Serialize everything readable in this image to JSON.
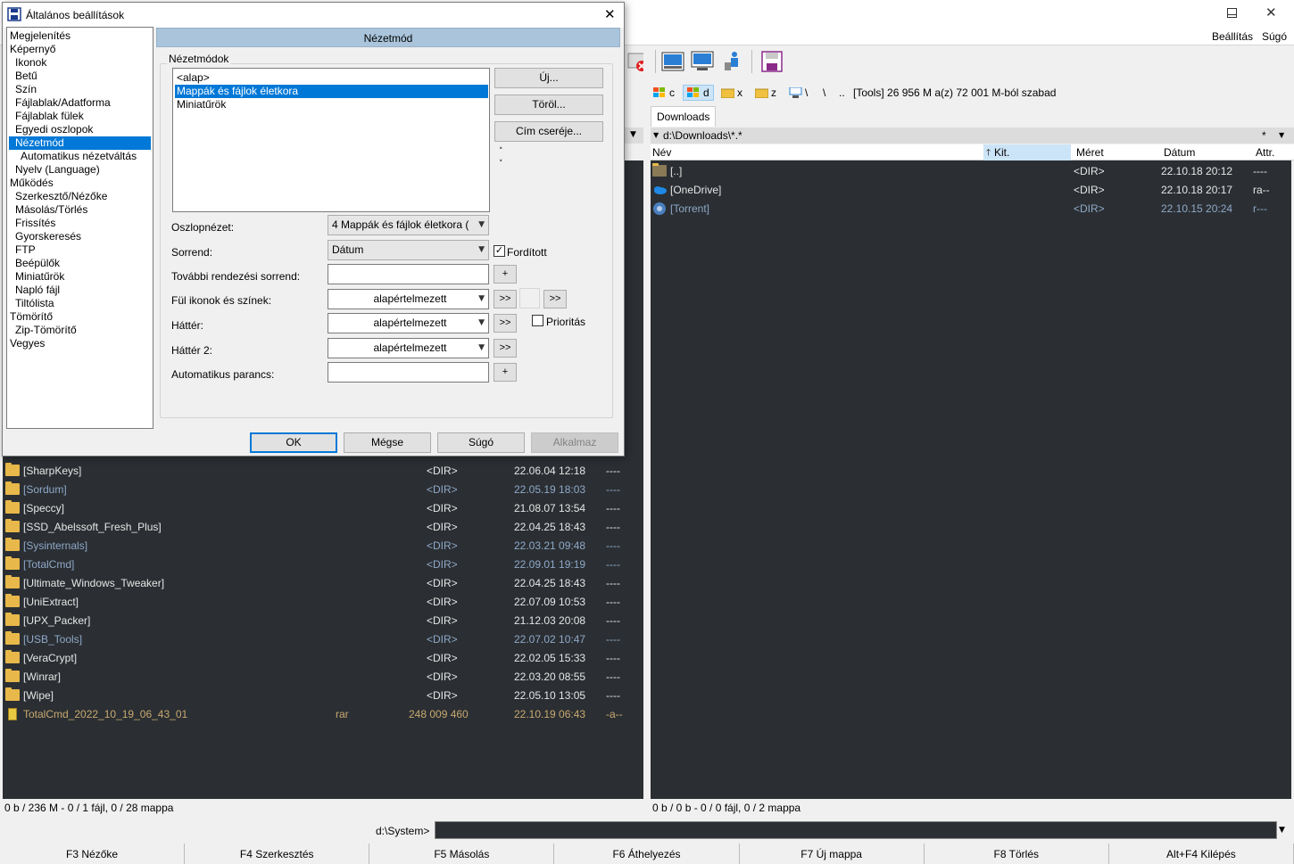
{
  "main": {
    "menu": {
      "settings": "Beállítás",
      "help": "Súgó"
    }
  },
  "drives": {
    "c": "c",
    "d": "d",
    "x": "x",
    "z": "z",
    "net": "\\",
    "root": "\\",
    "up": "..",
    "info": "[Tools]  26 956 M a(z) 72 001 M-ból szabad"
  },
  "right": {
    "tab": "Downloads",
    "path": "d:\\Downloads\\*.*",
    "path_btn": "*",
    "cols": {
      "name": "Név",
      "ext": "Kit.",
      "size": "Méret",
      "date": "Dátum",
      "attr": "Attr."
    },
    "rows": [
      {
        "name": "[..]",
        "size": "<DIR>",
        "date": "22.10.18 20:12",
        "attr": "----"
      },
      {
        "name": "[OneDrive]",
        "size": "<DIR>",
        "date": "22.10.18 20:17",
        "attr": "ra--"
      },
      {
        "name": "[Torrent]",
        "size": "<DIR>",
        "date": "22.10.15 20:24",
        "attr": "r---"
      }
    ],
    "status": "0 b / 0 b - 0 / 0 fájl, 0 / 2 mappa"
  },
  "left": {
    "rows": [
      {
        "name": "[SharpKeys]",
        "ext": "",
        "size": "<DIR>",
        "date": "22.06.04 12:18",
        "attr": "----",
        "kind": "dir"
      },
      {
        "name": "[Sordum]",
        "ext": "",
        "size": "<DIR>",
        "date": "22.05.19 18:03",
        "attr": "----",
        "kind": "dim"
      },
      {
        "name": "[Speccy]",
        "ext": "",
        "size": "<DIR>",
        "date": "21.08.07 13:54",
        "attr": "----",
        "kind": "dir"
      },
      {
        "name": "[SSD_Abelssoft_Fresh_Plus]",
        "ext": "",
        "size": "<DIR>",
        "date": "22.04.25 18:43",
        "attr": "----",
        "kind": "dir"
      },
      {
        "name": "[Sysinternals]",
        "ext": "",
        "size": "<DIR>",
        "date": "22.03.21 09:48",
        "attr": "----",
        "kind": "dim"
      },
      {
        "name": "[TotalCmd]",
        "ext": "",
        "size": "<DIR>",
        "date": "22.09.01 19:19",
        "attr": "----",
        "kind": "dim"
      },
      {
        "name": "[Ultimate_Windows_Tweaker]",
        "ext": "",
        "size": "<DIR>",
        "date": "22.04.25 18:43",
        "attr": "----",
        "kind": "dir"
      },
      {
        "name": "[UniExtract]",
        "ext": "",
        "size": "<DIR>",
        "date": "22.07.09 10:53",
        "attr": "----",
        "kind": "dir"
      },
      {
        "name": "[UPX_Packer]",
        "ext": "",
        "size": "<DIR>",
        "date": "21.12.03 20:08",
        "attr": "----",
        "kind": "dir"
      },
      {
        "name": "[USB_Tools]",
        "ext": "",
        "size": "<DIR>",
        "date": "22.07.02 10:47",
        "attr": "----",
        "kind": "dim"
      },
      {
        "name": "[VeraCrypt]",
        "ext": "",
        "size": "<DIR>",
        "date": "22.02.05 15:33",
        "attr": "----",
        "kind": "dir"
      },
      {
        "name": "[Winrar]",
        "ext": "",
        "size": "<DIR>",
        "date": "22.03.20 08:55",
        "attr": "----",
        "kind": "dir"
      },
      {
        "name": "[Wipe]",
        "ext": "",
        "size": "<DIR>",
        "date": "22.05.10 13:05",
        "attr": "----",
        "kind": "dir"
      },
      {
        "name": "TotalCmd_2022_10_19_06_43_01",
        "ext": "rar",
        "size": "248 009 460",
        "date": "22.10.19 06:43",
        "attr": "-a--",
        "kind": "archive"
      }
    ],
    "status": "0 b / 236 M - 0 / 1 fájl, 0 / 28 mappa"
  },
  "cmd": {
    "prompt": "d:\\System>"
  },
  "fkeys": [
    "F3 Nézőke",
    "F4 Szerkesztés",
    "F5 Másolás",
    "F6 Áthelyezés",
    "F7 Új mappa",
    "F8 Törlés",
    "Alt+F4 Kilépés"
  ],
  "dialog": {
    "title": "Általános beállítások",
    "close": "✕",
    "tree": [
      {
        "label": "Megjelenítés",
        "lvl": 0
      },
      {
        "label": "Képernyő",
        "lvl": 0
      },
      {
        "label": "Ikonok",
        "lvl": 1
      },
      {
        "label": "Betű",
        "lvl": 1
      },
      {
        "label": "Szín",
        "lvl": 1
      },
      {
        "label": "Fájlablak/Adatforma",
        "lvl": 1
      },
      {
        "label": "Fájlablak fülek",
        "lvl": 1
      },
      {
        "label": "Egyedi oszlopok",
        "lvl": 1
      },
      {
        "label": "Nézetmód",
        "lvl": 1,
        "selected": true
      },
      {
        "label": "Automatikus nézetváltás",
        "lvl": 2
      },
      {
        "label": "Nyelv (Language)",
        "lvl": 1
      },
      {
        "label": "Működés",
        "lvl": 0
      },
      {
        "label": "Szerkesztő/Nézőke",
        "lvl": 1
      },
      {
        "label": "Másolás/Törlés",
        "lvl": 1
      },
      {
        "label": "Frissítés",
        "lvl": 1
      },
      {
        "label": "Gyorskeresés",
        "lvl": 1
      },
      {
        "label": "FTP",
        "lvl": 1
      },
      {
        "label": "Beépülők",
        "lvl": 1
      },
      {
        "label": "Miniatűrök",
        "lvl": 1
      },
      {
        "label": "Napló fájl",
        "lvl": 1
      },
      {
        "label": "Tiltólista",
        "lvl": 1
      },
      {
        "label": "Tömörítő",
        "lvl": 0
      },
      {
        "label": "Zip-Tömörítő",
        "lvl": 1
      },
      {
        "label": "Vegyes",
        "lvl": 0
      }
    ],
    "section": "Nézetmód",
    "group": "Nézetmódok",
    "modes": [
      "<alap>",
      "Mappák és fájlok életkora",
      "Miniatűrök"
    ],
    "btn_new": "Új...",
    "btn_delete": "Töröl...",
    "btn_rename": "Cím cseréje...",
    "col_view_label": "Oszlopnézet:",
    "col_view_value": "4 Mappák és fájlok életkora (",
    "sort_label": "Sorrend:",
    "sort_value": "Dátum",
    "reverse_label": "Fordított",
    "more_sort_label": "További rendezési sorrend:",
    "tab_icons_label": "Fül ikonok és színek:",
    "tab_icons_value": "alapértelmezett",
    "bg_label": "Háttér:",
    "bg_value": "alapértelmezett",
    "priority_label": "Prioritás",
    "bg2_label": "Háttér 2:",
    "bg2_value": "alapértelmezett",
    "auto_cmd_label": "Automatikus parancs:",
    "plus": "+",
    "more": ">>",
    "ok": "OK",
    "cancel": "Mégse",
    "help": "Súgó",
    "apply": "Alkalmaz"
  }
}
